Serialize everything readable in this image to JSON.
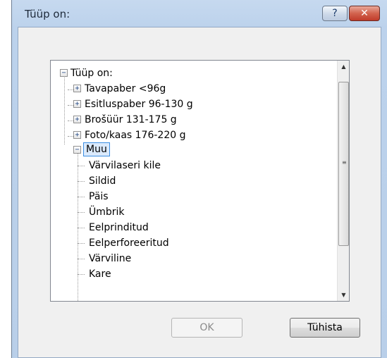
{
  "dialog": {
    "title": "Tüüp on:",
    "help_symbol": "?",
    "close_symbol": "✕"
  },
  "tree": {
    "root": "Tüüp on:",
    "groups": [
      "Tavapaber <96g",
      "Esitluspaber 96-130 g",
      "Brošüür 131-175 g",
      "Foto/kaas 176-220 g"
    ],
    "selected": "Muu",
    "children": [
      "Värvilaseri kile",
      "Sildid",
      "Päis",
      "Ümbrik",
      "Eelprinditud",
      "Eelperforeeritud",
      "Värviline",
      "Kare"
    ],
    "expanded_symbol": "−",
    "collapsed_symbol": "+"
  },
  "scrollbar": {
    "up": "▲",
    "down": "▼",
    "grip": "≡"
  },
  "buttons": {
    "ok": "OK",
    "cancel": "Tühista"
  }
}
